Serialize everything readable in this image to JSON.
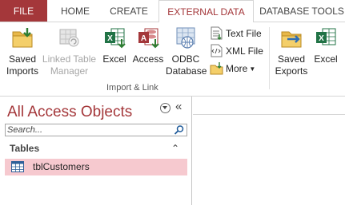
{
  "tabs": {
    "file": "FILE",
    "home": "HOME",
    "create": "CREATE",
    "external_data": "EXTERNAL DATA",
    "database_tools": "DATABASE TOOLS",
    "active": "EXTERNAL DATA"
  },
  "ribbon": {
    "saved_imports": {
      "line1": "Saved",
      "line2": "Imports"
    },
    "linked_table_manager": {
      "line1": "Linked Table",
      "line2": "Manager",
      "disabled": true
    },
    "excel_import": "Excel",
    "access_import": "Access",
    "odbc": {
      "line1": "ODBC",
      "line2": "Database"
    },
    "text_file": "Text File",
    "xml_file": "XML File",
    "more": "More",
    "group_import_link": "Import & Link",
    "saved_exports": {
      "line1": "Saved",
      "line2": "Exports"
    },
    "excel_export": "Excel"
  },
  "nav": {
    "title": "All Access Objects",
    "collapse_glyph": "«",
    "search_placeholder": "Search...",
    "section_label": "Tables",
    "section_glyph": "⌃",
    "items": [
      {
        "label": "tblCustomers",
        "icon": "table-icon",
        "selected": true
      }
    ]
  },
  "colors": {
    "accent": "#a4373a",
    "selected_row": "#f6c9cf",
    "excel_green": "#217346",
    "access_red": "#a4373a"
  }
}
